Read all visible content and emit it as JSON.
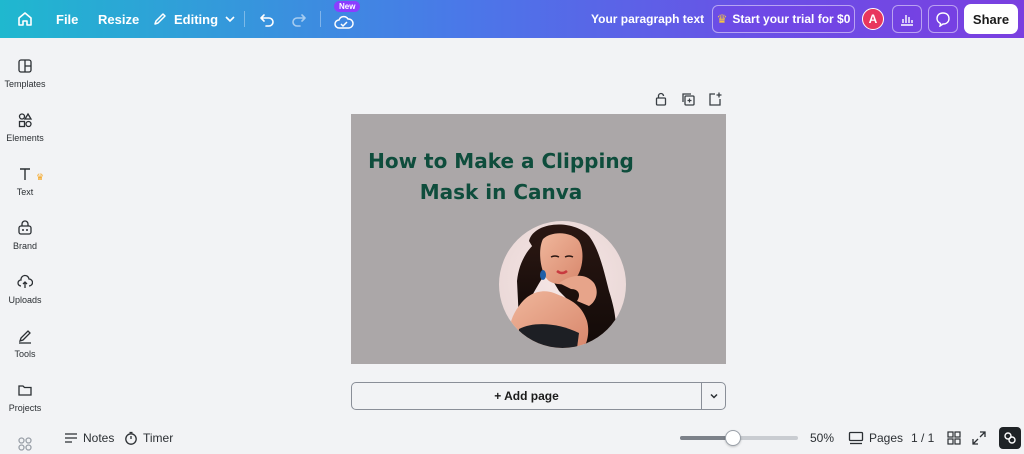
{
  "topbar": {
    "file_label": "File",
    "resize_label": "Resize",
    "editing_label": "Editing",
    "new_badge": "New",
    "doc_title": "Your paragraph text",
    "trial_label": "Start your trial for $0",
    "avatar_initial": "A",
    "share_label": "Share"
  },
  "sidebar": {
    "items": [
      {
        "label": "Templates",
        "icon": "templates-icon"
      },
      {
        "label": "Elements",
        "icon": "elements-icon"
      },
      {
        "label": "Text",
        "icon": "text-icon"
      },
      {
        "label": "Brand",
        "icon": "brand-icon"
      },
      {
        "label": "Uploads",
        "icon": "uploads-icon"
      },
      {
        "label": "Tools",
        "icon": "tools-icon"
      },
      {
        "label": "Projects",
        "icon": "projects-icon"
      }
    ]
  },
  "design": {
    "title_line1": "How to Make a Clipping",
    "title_line2": "Mask in Canva",
    "background_color": "#aba7a8",
    "title_color": "#0e4d3c"
  },
  "add_page_label": "+ Add page",
  "bottombar": {
    "notes_label": "Notes",
    "timer_label": "Timer",
    "zoom_label": "50%",
    "zoom_fraction": 0.45,
    "pages_label": "Pages",
    "page_count": "1 / 1"
  },
  "colors": {
    "accent": "#8b3dff",
    "avatar": "#e8365d"
  }
}
